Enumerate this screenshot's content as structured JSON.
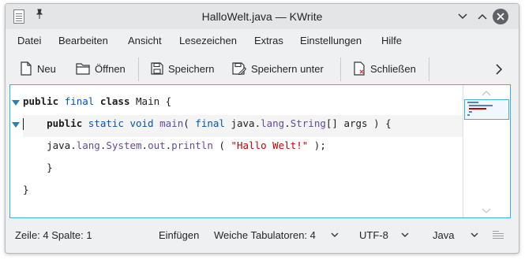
{
  "window": {
    "title": "HalloWelt.java — KWrite"
  },
  "menu": [
    {
      "label": "Datei"
    },
    {
      "label": "Bearbeiten"
    },
    {
      "label": "Ansicht"
    },
    {
      "label": "Lesezeichen"
    },
    {
      "label": "Extras"
    },
    {
      "label": "Einstellungen"
    },
    {
      "label": "Hilfe"
    }
  ],
  "toolbar": {
    "new_label": "Neu",
    "open_label": "Öffnen",
    "save_label": "Speichern",
    "save_as_label": "Speichern unter",
    "close_label": "Schließen"
  },
  "editor": {
    "lines": [
      "public final class Main {",
      "    public static void main( final java.lang.String[] args ) {",
      "    java.lang.System.out.println ( \"Hallo Welt!\" );",
      "    }",
      "}"
    ],
    "current_line": 2
  },
  "status": {
    "position": "Zeile: 4 Spalte: 1",
    "mode": "Einfügen",
    "tabs": "Weiche Tabulatoren: 4",
    "encoding": "UTF-8",
    "language": "Java"
  },
  "colors": {
    "accent": "#3daee9",
    "keyword_type": "#0057ae",
    "string": "#bf0303",
    "function": "#644a9b"
  }
}
